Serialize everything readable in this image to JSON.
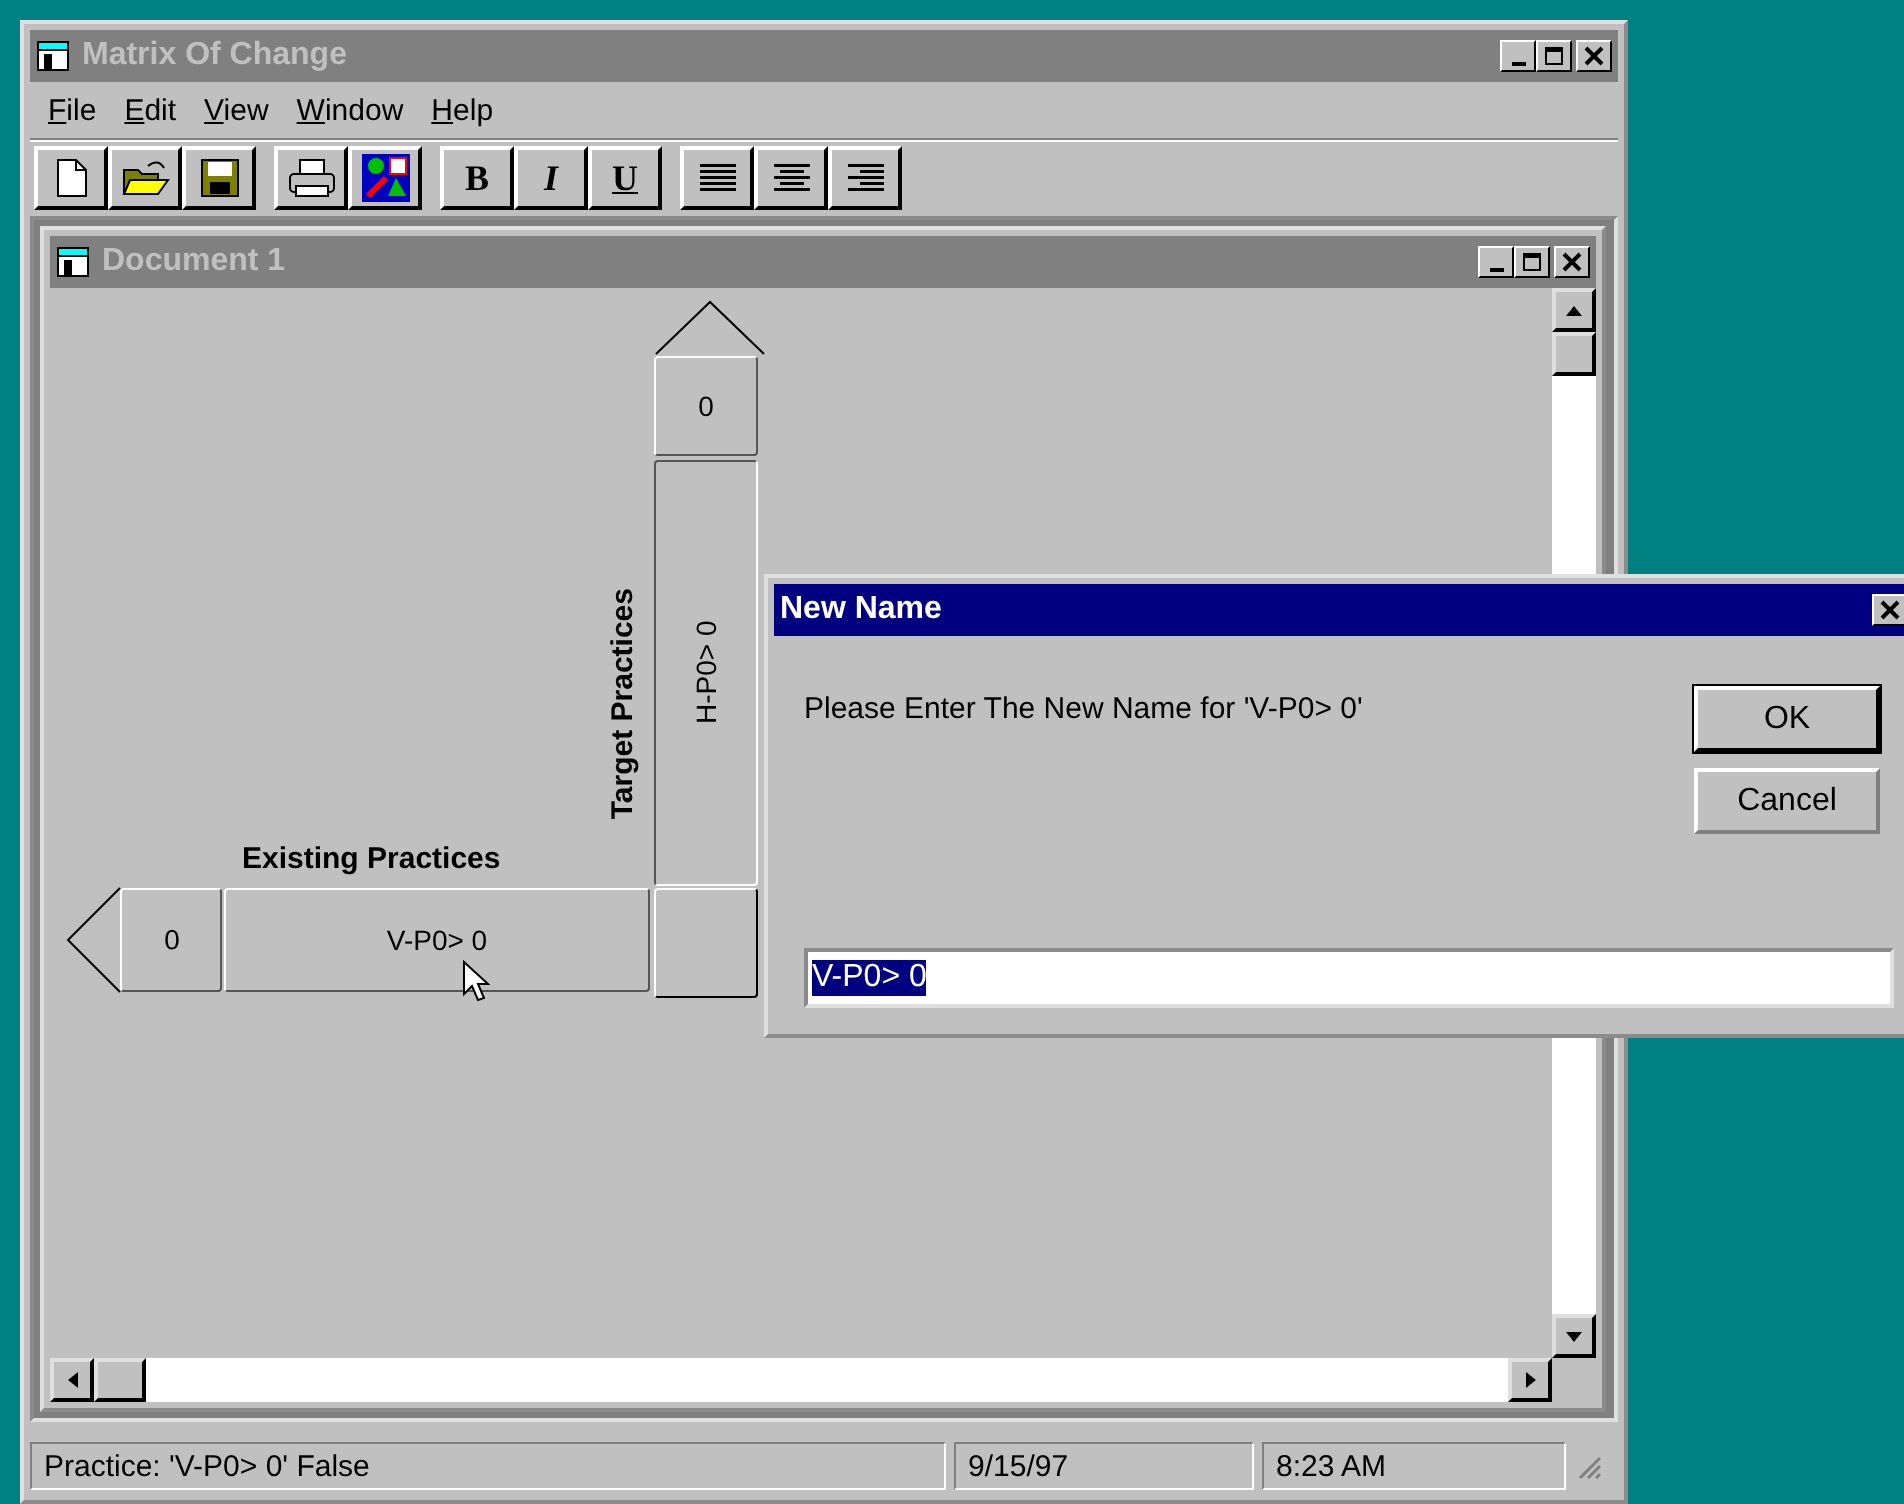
{
  "window": {
    "title": "Matrix Of Change",
    "active": false
  },
  "menu": [
    {
      "label": "File"
    },
    {
      "label": "Edit"
    },
    {
      "label": "View"
    },
    {
      "label": "Window"
    },
    {
      "label": "Help"
    }
  ],
  "format_buttons": [
    "B",
    "I",
    "U"
  ],
  "document": {
    "title": "Document 1",
    "active": false,
    "diagram": {
      "top_cell": "0",
      "vertical_label": "Target Practices",
      "vertical_practice": "H-P0> 0",
      "horizontal_label": "Existing Practices",
      "horizontal_practice": "V-P0> 0",
      "left_cell": "0"
    }
  },
  "dialog": {
    "title": "New Name",
    "prompt": "Please Enter The New Name for 'V-P0> 0'",
    "buttons": [
      {
        "label": "OK",
        "default": true
      },
      {
        "label": "Cancel",
        "default": false
      }
    ],
    "field": {
      "value": "V-P0> 0",
      "text_selected": true
    }
  },
  "status_bar": [
    "Practice: 'V-P0> 0' False",
    "9/15/97",
    "8:23 AM"
  ]
}
